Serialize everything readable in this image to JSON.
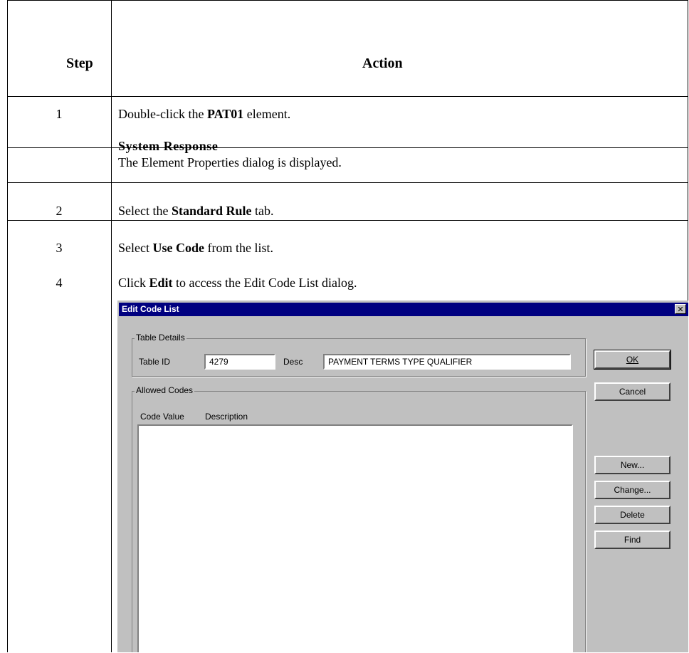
{
  "table": {
    "header": {
      "step": "Step",
      "action": "Action"
    },
    "rows": [
      {
        "step": "1",
        "action_pre": "Double-click the ",
        "action_bold": "PAT01",
        "action_post": " element.",
        "response_title": "System Response",
        "response_text": "The Element Properties dialog is displayed."
      },
      {
        "step": "2",
        "action_pre": "Select the ",
        "action_bold": "Standard Rule",
        "action_post": " tab."
      },
      {
        "step": "3",
        "action_pre": "Select ",
        "action_bold": "Use Code",
        "action_post": " from the list."
      },
      {
        "step": "4",
        "action_pre": "Click ",
        "action_bold": "Edit",
        "action_post": " to access the Edit Code List dialog."
      }
    ]
  },
  "dialog": {
    "title": "Edit Code List",
    "close_glyph": "✕",
    "table_details": {
      "legend": "Table Details",
      "table_id_label": "Table ID",
      "table_id_value": "4279",
      "desc_label": "Desc",
      "desc_value": "PAYMENT TERMS TYPE QUALIFIER"
    },
    "allowed_codes": {
      "legend": "Allowed Codes",
      "col_code": "Code Value",
      "col_description": "Description",
      "items": []
    },
    "buttons": {
      "ok": "OK",
      "cancel": "Cancel",
      "new": "New...",
      "change": "Change...",
      "delete": "Delete",
      "find": "Find"
    }
  }
}
